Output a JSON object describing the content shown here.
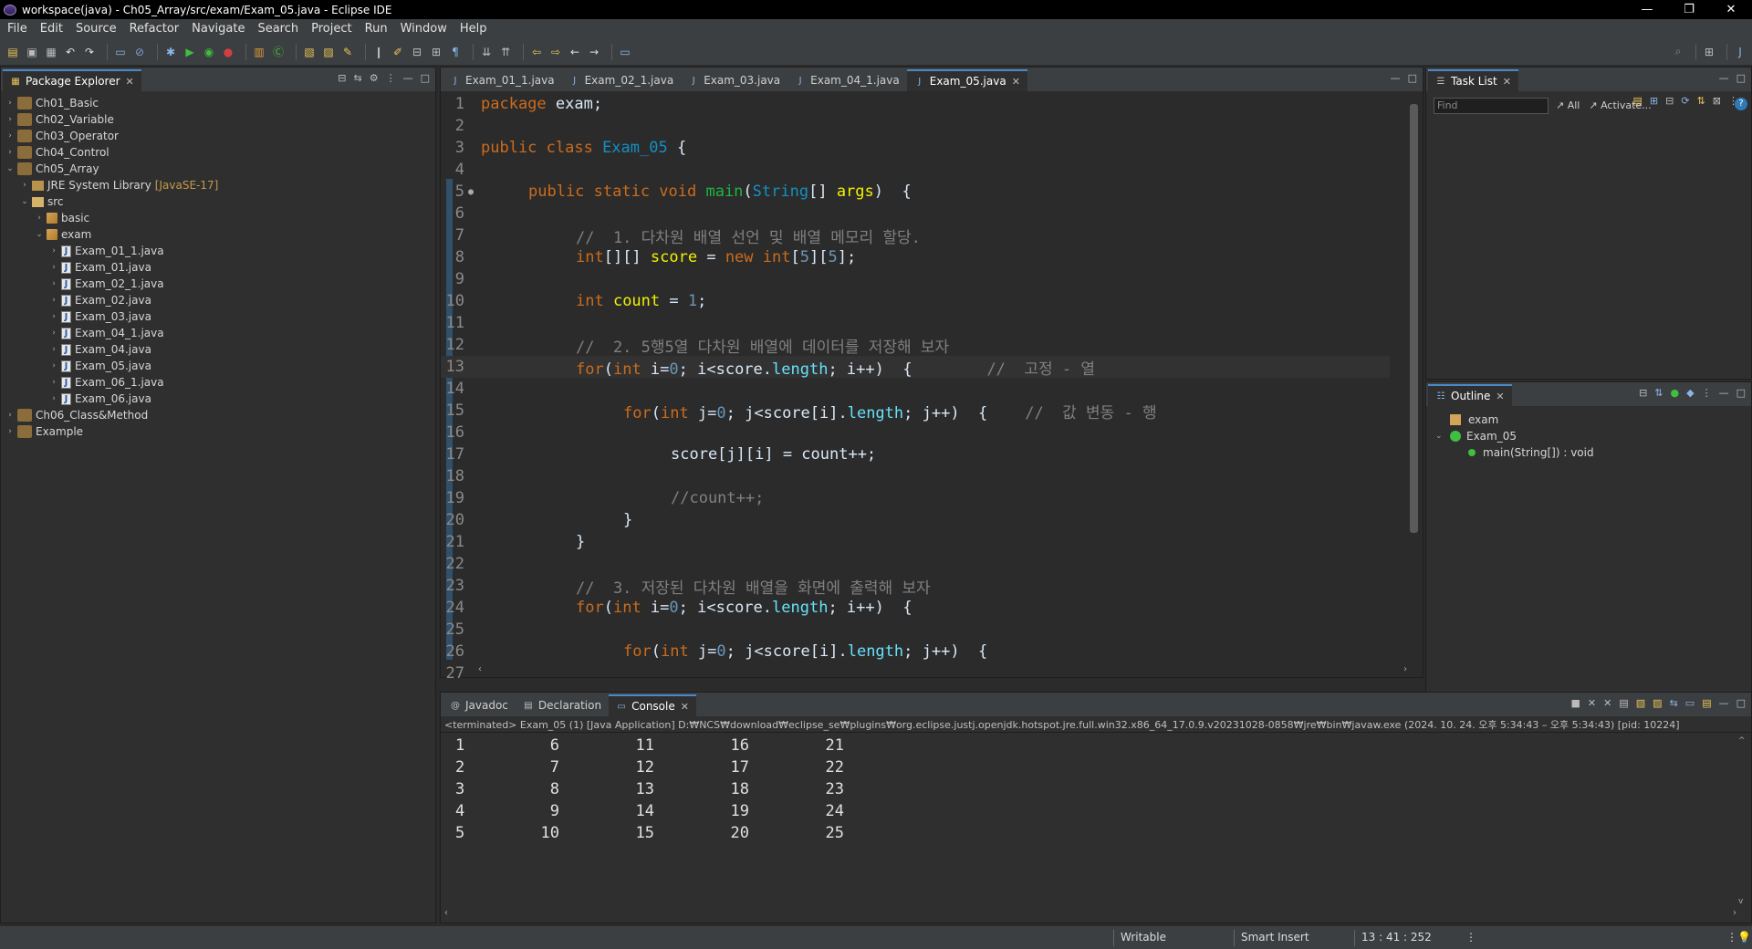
{
  "window": {
    "title": "workspace(java) - Ch05_Array/src/exam/Exam_05.java - Eclipse IDE"
  },
  "menu": [
    "File",
    "Edit",
    "Source",
    "Refactor",
    "Navigate",
    "Search",
    "Project",
    "Run",
    "Window",
    "Help"
  ],
  "package_explorer": {
    "tab_label": "Package Explorer",
    "projects": [
      "Ch01_Basic",
      "Ch02_Variable",
      "Ch03_Operator",
      "Ch04_Control",
      "Ch05_Array"
    ],
    "jre_label": "JRE System Library",
    "jre_version": "[JavaSE-17]",
    "src_label": "src",
    "packages": [
      "basic",
      "exam"
    ],
    "files": [
      "Exam_01_1.java",
      "Exam_01.java",
      "Exam_02_1.java",
      "Exam_02.java",
      "Exam_03.java",
      "Exam_04_1.java",
      "Exam_04.java",
      "Exam_05.java",
      "Exam_06_1.java",
      "Exam_06.java"
    ],
    "projects_after": [
      "Ch06_Class&Method",
      "Example"
    ]
  },
  "editor": {
    "tabs": [
      "Exam_01_1.java",
      "Exam_02_1.java",
      "Exam_03.java",
      "Exam_04_1.java",
      "Exam_05.java"
    ],
    "active_tab": "Exam_05.java",
    "line_numbers": [
      "1",
      "2",
      "3",
      "4",
      "5",
      "6",
      "7",
      "8",
      "9",
      "10",
      "11",
      "12",
      "13",
      "14",
      "15",
      "16",
      "17",
      "18",
      "19",
      "20",
      "21",
      "22",
      "23",
      "24",
      "25",
      "26",
      "27"
    ],
    "code": {
      "l1_kw": "package",
      "l1_rest": " exam;",
      "l3_kw": "public class ",
      "l3_cls": "Exam_05",
      "l3_rest": " {",
      "l5_kw": "public static void ",
      "l5_mth": "main",
      "l5_p1": "(",
      "l5_cls": "String",
      "l5_p2": "[] ",
      "l5_var": "args",
      "l5_p3": ")  {",
      "l7_cmt": "//  1. 다차원 배열 선언 및 배열 메모리 할당.",
      "l8_kw": "int",
      "l8_p1": "[][] ",
      "l8_var": "score",
      "l8_p2": " = ",
      "l8_kw2": "new",
      "l8_kw3": " int",
      "l8_p3": "[",
      "l8_n1": "5",
      "l8_p4": "][",
      "l8_n2": "5",
      "l8_p5": "];",
      "l10_kw": "int",
      "l10_var": " count",
      "l10_p1": " = ",
      "l10_n": "1",
      "l10_p2": ";",
      "l12_cmt": "//  2. 5행5열 다차원 배열에 데이터를 저장해 보자",
      "l13_kw": "for",
      "l13_p1": "(",
      "l13_kw2": "int",
      "l13_p2": " i=",
      "l13_n": "0",
      "l13_p3": "; i<score.",
      "l13_fld": "length",
      "l13_p4": "; i++)  {",
      "l13_cmt": "        //  고정 - 열",
      "l15_kw": "for",
      "l15_p1": "(",
      "l15_kw2": "int",
      "l15_p2": " j=",
      "l15_n": "0",
      "l15_p3": "; j<score[i].",
      "l15_fld": "length",
      "l15_p4": "; j++)  {",
      "l15_cmt": "    //  값 변동 - 행",
      "l17_text": "score[j][i] = count++;",
      "l19_cmt": "//count++;",
      "l20_text": "}",
      "l21_text": "}",
      "l23_cmt": "//  3. 저장된 다차원 배열을 화면에 출력해 보자",
      "l24_kw": "for",
      "l24_p1": "(",
      "l24_kw2": "int",
      "l24_p2": " i=",
      "l24_n": "0",
      "l24_p3": "; i<score.",
      "l24_fld": "length",
      "l24_p4": "; i++)  {",
      "l26_kw": "for",
      "l26_p1": "(",
      "l26_kw2": "int",
      "l26_p2": " j=",
      "l26_n": "0",
      "l26_p3": "; j<score[i].",
      "l26_fld": "length",
      "l26_p4": "; j++)  {"
    }
  },
  "task_list": {
    "tab_label": "Task List",
    "find_placeholder": "Find",
    "all_label": "All",
    "activate_label": "Activate..."
  },
  "outline": {
    "tab_label": "Outline",
    "package": "exam",
    "class": "Exam_05",
    "method": "main(String[]) : void"
  },
  "bottom_tabs": [
    "Javadoc",
    "Declaration",
    "Console"
  ],
  "console": {
    "header": "<terminated> Exam_05 (1) [Java Application] D:₩NCS₩download₩eclipse_se₩plugins₩org.eclipse.justj.openjdk.hotspot.jre.full.win32.x86_64_17.0.9.v20231028-0858₩jre₩bin₩javaw.exe  (2024. 10. 24. 오후 5:34:43 – 오후 5:34:43) [pid: 10224]",
    "rows": [
      [
        "1",
        "6",
        "11",
        "16",
        "21"
      ],
      [
        "2",
        "7",
        "12",
        "17",
        "22"
      ],
      [
        "3",
        "8",
        "13",
        "18",
        "23"
      ],
      [
        "4",
        "9",
        "14",
        "19",
        "24"
      ],
      [
        "5",
        "10",
        "15",
        "20",
        "25"
      ]
    ]
  },
  "status": {
    "writable": "Writable",
    "insert_mode": "Smart Insert",
    "position": "13 : 41 : 252"
  },
  "colors": {
    "accent": "#4a88c7",
    "keyword": "#cc6c1d",
    "class": "#1290c3",
    "comment": "#808080"
  }
}
